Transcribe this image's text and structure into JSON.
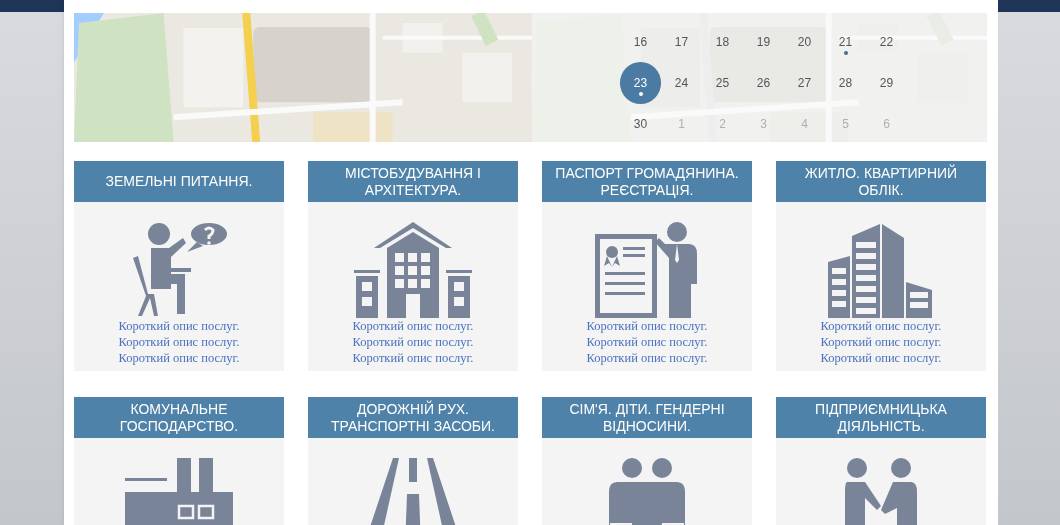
{
  "calendar": {
    "weeks": [
      [
        {
          "label": "16",
          "selected": false,
          "event": false,
          "muted": false
        },
        {
          "label": "17",
          "selected": false,
          "event": false,
          "muted": false
        },
        {
          "label": "18",
          "selected": false,
          "event": false,
          "muted": false
        },
        {
          "label": "19",
          "selected": false,
          "event": false,
          "muted": false
        },
        {
          "label": "20",
          "selected": false,
          "event": false,
          "muted": false
        },
        {
          "label": "21",
          "selected": false,
          "event": true,
          "muted": false
        },
        {
          "label": "22",
          "selected": false,
          "event": false,
          "muted": false
        }
      ],
      [
        {
          "label": "23",
          "selected": true,
          "event": true,
          "muted": false
        },
        {
          "label": "24",
          "selected": false,
          "event": false,
          "muted": false
        },
        {
          "label": "25",
          "selected": false,
          "event": false,
          "muted": false
        },
        {
          "label": "26",
          "selected": false,
          "event": false,
          "muted": false
        },
        {
          "label": "27",
          "selected": false,
          "event": false,
          "muted": false
        },
        {
          "label": "28",
          "selected": false,
          "event": false,
          "muted": false
        },
        {
          "label": "29",
          "selected": false,
          "event": false,
          "muted": false
        }
      ],
      [
        {
          "label": "30",
          "selected": false,
          "event": false,
          "muted": false
        },
        {
          "label": "1",
          "selected": false,
          "event": false,
          "muted": true
        },
        {
          "label": "2",
          "selected": false,
          "event": false,
          "muted": true
        },
        {
          "label": "3",
          "selected": false,
          "event": false,
          "muted": true
        },
        {
          "label": "4",
          "selected": false,
          "event": false,
          "muted": true
        },
        {
          "label": "5",
          "selected": false,
          "event": false,
          "muted": true
        },
        {
          "label": "6",
          "selected": false,
          "event": false,
          "muted": true
        }
      ]
    ]
  },
  "services": [
    {
      "title": "ЗЕМЕЛЬНІ ПИТАННЯ.",
      "description": [
        "Короткий опис послуг.",
        "Короткий опис послуг.",
        "Короткий опис послуг."
      ]
    },
    {
      "title": "МІСТОБУДУВАННЯ І АРХІТЕКТУРА.",
      "description": [
        "Короткий опис послуг.",
        "Короткий опис послуг.",
        "Короткий опис послуг."
      ]
    },
    {
      "title": "ПАСПОРТ ГРОМАДЯНИНА. РЕЄСТРАЦІЯ.",
      "description": [
        "Короткий опис послуг.",
        "Короткий опис послуг.",
        "Короткий опис послуг."
      ]
    },
    {
      "title": "ЖИТЛО. КВАРТИРНИЙ ОБЛІК.",
      "description": [
        "Короткий опис послуг.",
        "Короткий опис послуг.",
        "Короткий опис послуг."
      ]
    },
    {
      "title": "КОМУНАЛЬНЕ ГОСПОДАРСТВО."
    },
    {
      "title": "ДОРОЖНІЙ РУХ. ТРАНСПОРТНІ ЗАСОБИ."
    },
    {
      "title": "СІМ'Я. ДІТИ. ГЕНДЕРНІ ВІДНОСИНИ."
    },
    {
      "title": "ПІДПРИЄМНИЦЬКА ДІЯЛЬНІСТЬ."
    }
  ]
}
